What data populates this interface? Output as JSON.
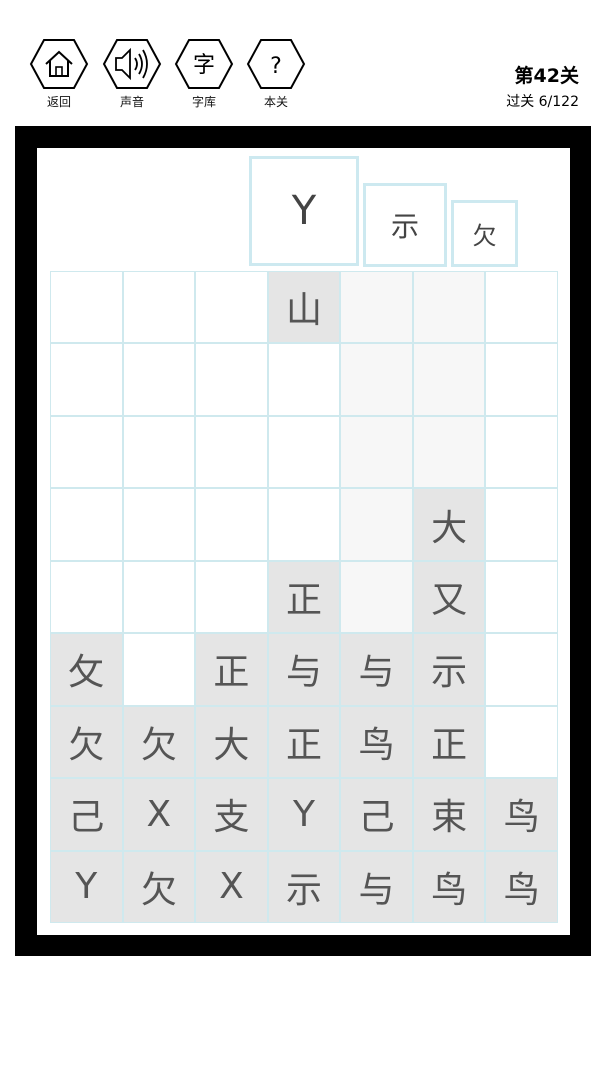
{
  "toolbar": {
    "home_label": "返回",
    "sound_label": "声音",
    "dict_label": "字库",
    "dict_glyph": "字",
    "level_label": "本关",
    "level_glyph": "?"
  },
  "level": {
    "title": "第42关",
    "progress": "过关 6/122"
  },
  "candidates": [
    "Y",
    "示",
    "欠"
  ],
  "grid": {
    "rows": [
      [
        "",
        "",
        "",
        "山",
        "",
        "",
        ""
      ],
      [
        "",
        "",
        "",
        "",
        "",
        "",
        ""
      ],
      [
        "",
        "",
        "",
        "",
        "",
        "",
        ""
      ],
      [
        "",
        "",
        "",
        "",
        "",
        "大",
        ""
      ],
      [
        "",
        "",
        "",
        "正",
        "",
        "又",
        ""
      ],
      [
        "攵",
        "",
        "正",
        "与",
        "与",
        "示",
        ""
      ],
      [
        "欠",
        "欠",
        "大",
        "正",
        "鸟",
        "正",
        ""
      ],
      [
        "己",
        "X",
        "支",
        "Y",
        "己",
        "束",
        "鸟"
      ],
      [
        "Y",
        "欠",
        "X",
        "示",
        "与",
        "鸟",
        "鸟"
      ]
    ]
  },
  "colors": {
    "grid_line": "#cfe9ee",
    "filled_cell": "#e5e5e5",
    "frame": "#000000"
  }
}
